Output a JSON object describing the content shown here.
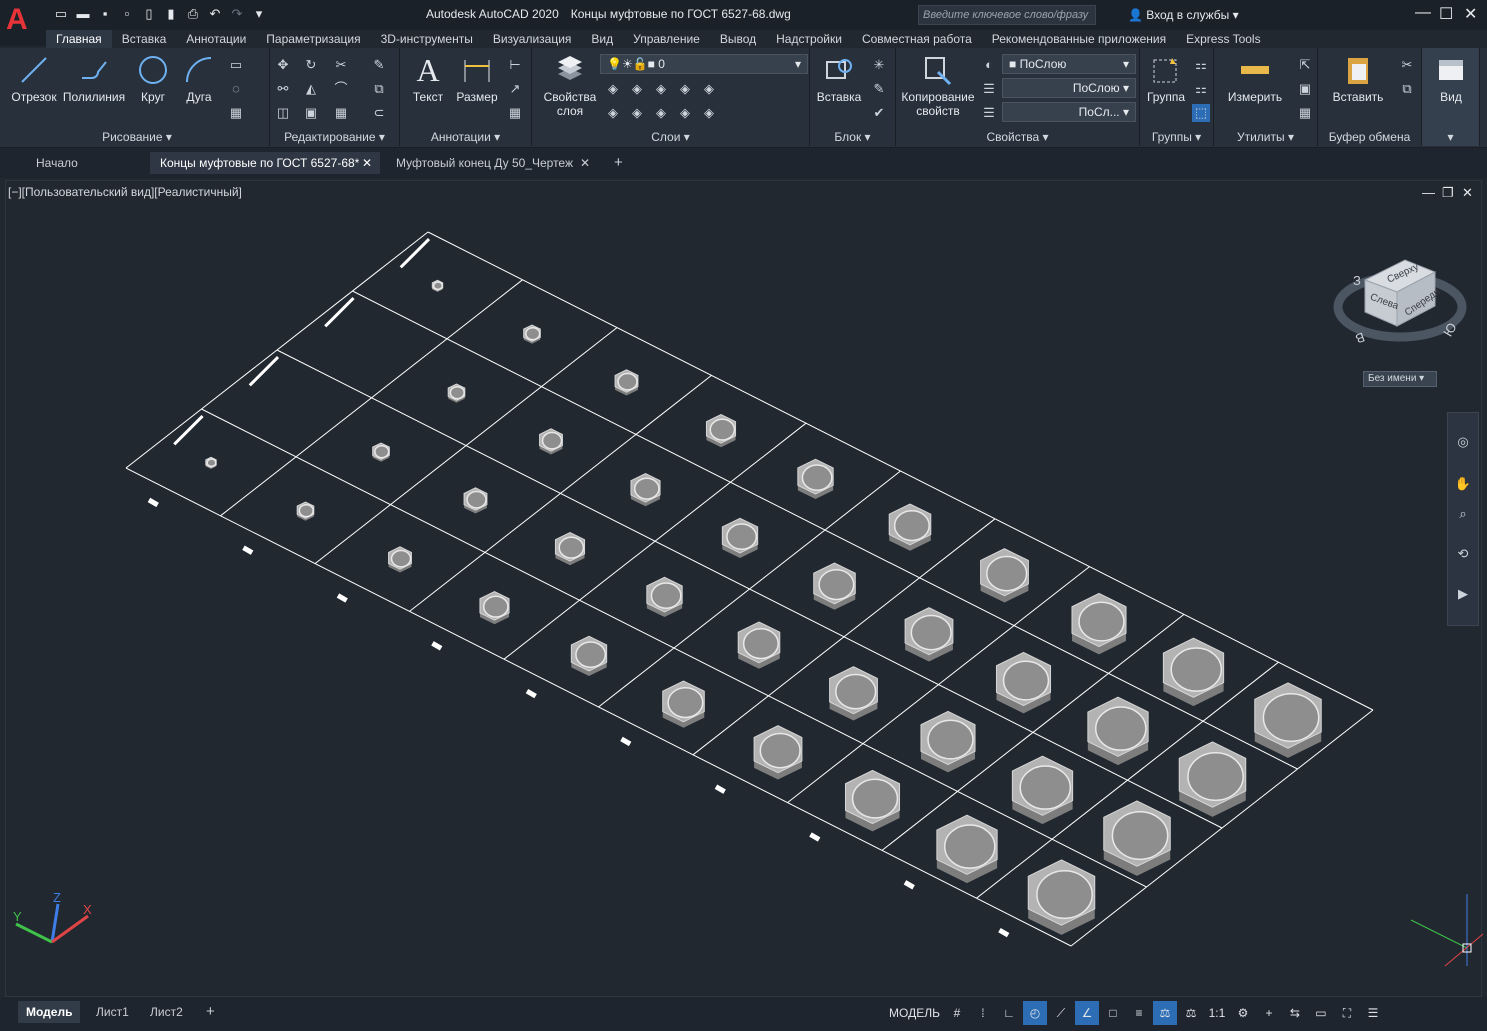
{
  "app": {
    "title": "Autodesk AutoCAD 2020",
    "document": "Концы муфтовые по ГОСТ 6527-68.dwg",
    "search_placeholder": "Введите ключевое слово/фразу",
    "signin": "Вход в службы",
    "logo_letter": "A",
    "accent": "#e7343a"
  },
  "menu": [
    "Главная",
    "Вставка",
    "Аннотации",
    "Параметризация",
    "3D-инструменты",
    "Визуализация",
    "Вид",
    "Управление",
    "Вывод",
    "Надстройки",
    "Совместная работа",
    "Рекомендованные приложения",
    "Express Tools"
  ],
  "ribbon": {
    "draw": {
      "title": "Рисование",
      "line": "Отрезок",
      "polyline": "Полилиния",
      "circle": "Круг",
      "arc": "Дуга"
    },
    "modify": {
      "title": "Редактирование"
    },
    "annotate": {
      "title": "Аннотации",
      "text": "Текст",
      "dimension": "Размер"
    },
    "layers": {
      "title": "Слои",
      "layer_props": "Свойства\nслоя",
      "current_layer": "0"
    },
    "block": {
      "title": "Блок",
      "insert": "Вставка"
    },
    "properties": {
      "title": "Свойства",
      "match": "Копирование\nсвойств",
      "color": "ПоСлою",
      "linetype": "ПоСлою",
      "lineweight": "ПоСл..."
    },
    "groups": {
      "title": "Группы",
      "group": "Группа"
    },
    "utilities": {
      "title": "Утилиты",
      "measure": "Измерить"
    },
    "clipboard": {
      "title": "Буфер обмена",
      "paste": "Вставить"
    },
    "view": {
      "title": "Вид"
    }
  },
  "tabs": [
    "Начало",
    "Концы муфтовые по ГОСТ 6527-68*",
    "Муфтовый конец Ду 50_Чертеж"
  ],
  "viewport": {
    "label": "[−][Пользовательский вид][Реалистичный]",
    "viewcube_top": "Сверху",
    "viewcube_left": "Слева",
    "viewcube_front": "Спереди",
    "viewcube_w": "З",
    "viewcube_s": "Ю",
    "named_view": "Без имени"
  },
  "layouts": [
    "Модель",
    "Лист1",
    "Лист2"
  ],
  "status": {
    "model": "МОДЕЛЬ",
    "scale": "1:1"
  }
}
